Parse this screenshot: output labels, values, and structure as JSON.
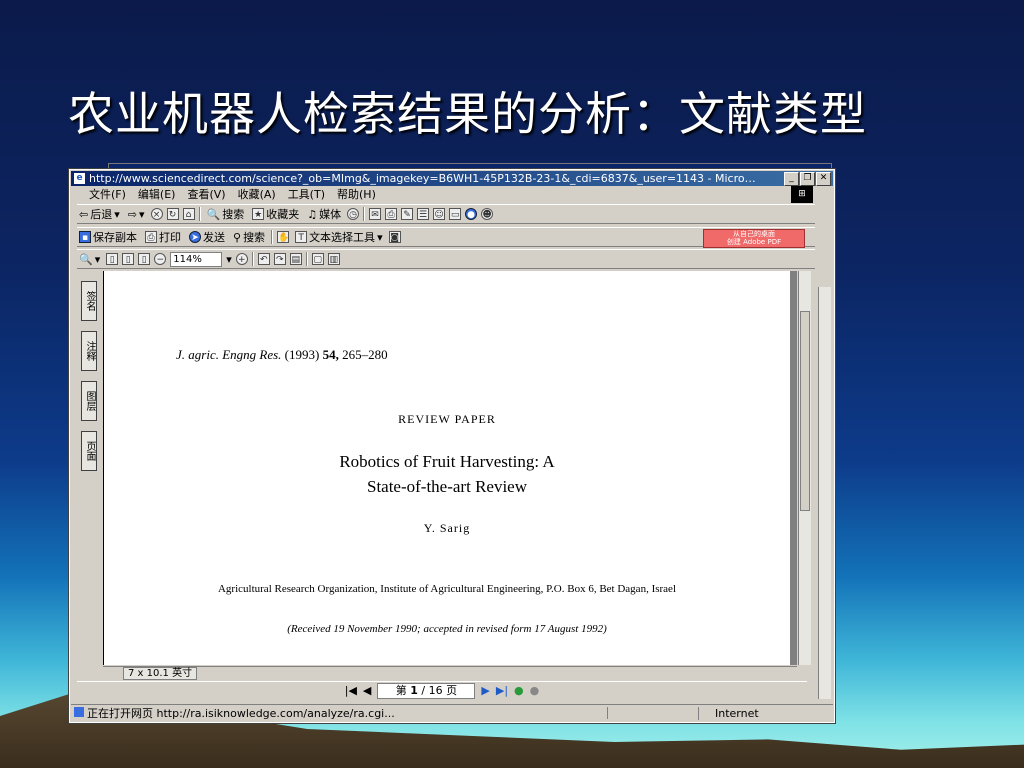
{
  "slide": {
    "title": "农业机器人检索结果的分析：文献类型"
  },
  "browser": {
    "title": "http://www.sciencedirect.com/science?_ob=MImg&_imagekey=B6WH1-45P132B-23-1&_cdi=6837&_user=1143 - Microsoft Interne...",
    "menu": [
      "文件(F)",
      "编辑(E)",
      "查看(V)",
      "收藏(A)",
      "工具(T)",
      "帮助(H)"
    ],
    "toolbar": {
      "back": "后退",
      "search": "搜索",
      "favorites": "收藏夹",
      "media": "媒体"
    },
    "status_text": "正在打开网页 http://ra.isiknowledge.com/analyze/ra.cgi...",
    "zone": "Internet"
  },
  "pdf": {
    "save_copy": "保存副本",
    "print": "打印",
    "send": "发送",
    "search": "搜索",
    "text_select": "文本选择工具",
    "adobe_line1": "从自己的桌面",
    "adobe_line2": "创建 Adobe PDF",
    "zoom": "114%",
    "nav_tabs": [
      "签名",
      "注释",
      "图层",
      "页面"
    ],
    "page_size": "7 x 10.1 英寸",
    "page_nav": {
      "prefix": "第",
      "current": "1",
      "separator": "/",
      "total": "16",
      "suffix": "页"
    }
  },
  "document": {
    "journal_italic": "J. agric. Engng Res.",
    "journal_year": "(1993)",
    "journal_volume": "54,",
    "journal_pages": "265–280",
    "type": "REVIEW PAPER",
    "title_line1": "Robotics of Fruit Harvesting: A",
    "title_line2": "State-of-the-art Review",
    "author": "Y. Sarig",
    "affiliation": "Agricultural Research Organization, Institute of Agricultural Engineering, P.O. Box 6, Bet Dagan, Israel",
    "received": "(Received 19 November 1990; accepted in revised form 17 August 1992)"
  }
}
